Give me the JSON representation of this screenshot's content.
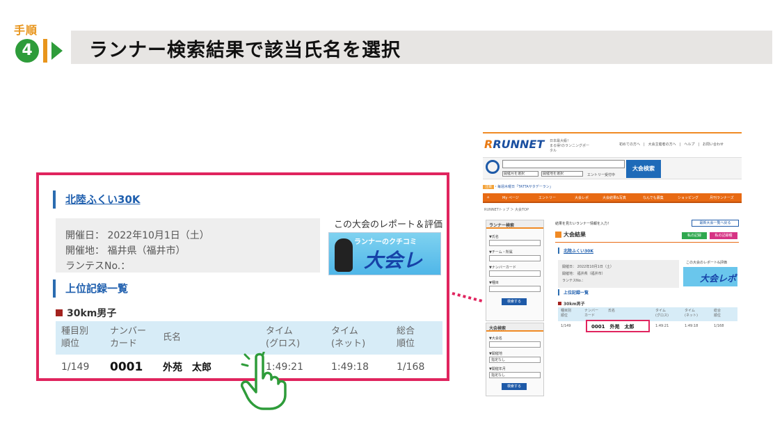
{
  "header": {
    "step_label": "手順",
    "step_number": "4",
    "title": "ランナー検索結果で該当氏名を選択"
  },
  "zoom": {
    "event_title": "北陸ふくい30K",
    "info": {
      "date": "開催日： 2022年10月1日（土）",
      "place": "開催地： 福井県（福井市）",
      "runtes": "ランテスNo.："
    },
    "report_caption": "この大会のレポート＆評価",
    "banner_small": "ランナーのクチコミ",
    "banner_main": "大会レポ",
    "ranking_title": "上位記録一覧",
    "category": "30km男子",
    "columns": [
      "種目別\n順位",
      "ナンバー\nカード",
      "氏名",
      "タイム\n(グロス)",
      "タイム\n(ネット)",
      "総合\n順位"
    ],
    "row": {
      "rank": "1/149",
      "bib": "0001",
      "name": "外苑　太郎",
      "gross": "1:49:21",
      "net": "1:49:18",
      "overall": "1/168"
    }
  },
  "mini": {
    "logo": "RUNNET",
    "tagline": "日本最大級！\nまる得!のランニングポータル",
    "toplinks": "初めての方へ　|　大会主催者の方へ　|　ヘルプ　|　お問い合わせ",
    "search_button": "大会検索",
    "select_type": "開催月を選択",
    "select_place": "開催地を選択",
    "entry_only": "エントリー受付中",
    "notice_tag": "注目",
    "notice_text": "・毎週木曜日「TATTAサタデーラン」",
    "nav": [
      "My ページ",
      "エントリー",
      "大会レポ",
      "大会結果&写真",
      "なんでも募集",
      "ショッピング",
      "月刊ランナーズ"
    ],
    "breadcrumb": "RUNNETトップ ＞ 大会TOP",
    "sidebar": {
      "head": "ランナー検索",
      "name": "▼氏名",
      "team": "▼チーム・所属",
      "bib": "▼ナンバーカード",
      "event": "▼種目",
      "button": "検索する"
    },
    "sidebar2": {
      "head": "大会検索",
      "name": "▼大会名",
      "place": "▼開催地",
      "place_value": "指定なし",
      "month": "▼開催年月",
      "month_value": "指定なし",
      "button": "検索する"
    },
    "message": "結果を見たいランナー情報を入力！",
    "back_button": "最新大会一覧へ戻る",
    "results_head": "大会結果",
    "my_record": "私の記録",
    "my_record2": "私の記録種",
    "event_title": "北陸ふくい30K",
    "info_date": "開催日： 2022年10月1日（土）",
    "info_place": "開催地： 福井県（福井市）",
    "info_runtes": "ランテスNo.：",
    "report_caption": "この大会のレポート&評価",
    "banner": "大会レポ",
    "ranking_title": "上位記録一覧",
    "category": "30km男子",
    "cols": [
      "種目別\n順位",
      "ナンバー\nカード",
      "氏名",
      "タイム\n(グロス)",
      "タイム\n(ネット)",
      "総合\n順位"
    ],
    "row": {
      "rank": "1/149",
      "bib": "0001",
      "name": "外苑　太郎",
      "gross": "1:49:21",
      "net": "1:49:18",
      "overall": "1/168"
    }
  },
  "colors": {
    "highlight": "#e0245e",
    "step_green": "#2e9c3a",
    "step_orange": "#e8951c",
    "link_blue": "#1f5fae",
    "nav_orange": "#e86a13"
  }
}
